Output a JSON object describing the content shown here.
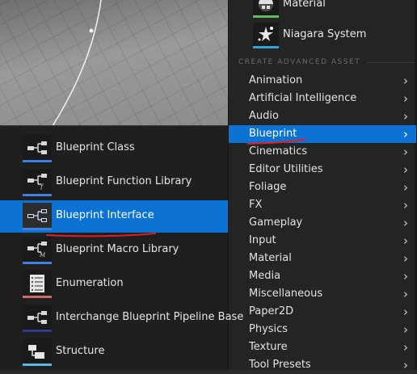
{
  "asset_tiles": [
    {
      "label": "Material",
      "icon": "material-sphere-icon",
      "underline_color": "#5dbb63"
    },
    {
      "label": "Niagara System",
      "icon": "niagara-system-icon",
      "underline_color": "#2fa6d9"
    }
  ],
  "section_header": "CREATE ADVANCED ASSET",
  "menu_items": [
    {
      "label": "Animation"
    },
    {
      "label": "Artificial Intelligence"
    },
    {
      "label": "Audio"
    },
    {
      "label": "Blueprint",
      "selected": true
    },
    {
      "label": "Cinematics"
    },
    {
      "label": "Editor Utilities"
    },
    {
      "label": "Foliage"
    },
    {
      "label": "FX"
    },
    {
      "label": "Gameplay"
    },
    {
      "label": "Input"
    },
    {
      "label": "Material"
    },
    {
      "label": "Media"
    },
    {
      "label": "Miscellaneous"
    },
    {
      "label": "Paper2D"
    },
    {
      "label": "Physics"
    },
    {
      "label": "Texture"
    },
    {
      "label": "Tool Presets"
    }
  ],
  "submenu_items": [
    {
      "label": "Blueprint Class",
      "icon": "blueprint-class-icon",
      "underline_color": "#3f7fe0"
    },
    {
      "label": "Blueprint Function Library",
      "icon": "blueprint-function-library-icon",
      "underline_color": "#3f7fe0"
    },
    {
      "label": "Blueprint Interface",
      "icon": "blueprint-interface-icon",
      "underline_color": "#3f7fe0",
      "selected": true
    },
    {
      "label": "Blueprint Macro Library",
      "icon": "blueprint-macro-library-icon",
      "underline_color": "#3f7fe0"
    },
    {
      "label": "Enumeration",
      "icon": "enumeration-icon",
      "underline_color": "#d06a6a"
    },
    {
      "label": "Interchange Blueprint Pipeline Base",
      "icon": "interchange-blueprint-pipeline-icon",
      "underline_color": "#2c3b8f"
    },
    {
      "label": "Structure",
      "icon": "structure-icon",
      "underline_color": "#5ab7e0"
    }
  ],
  "colors": {
    "selection": "#0c73d4",
    "annotation_red": "#e02020",
    "panel_bg": "#242424",
    "submenu_bg": "#1f1f1f"
  }
}
